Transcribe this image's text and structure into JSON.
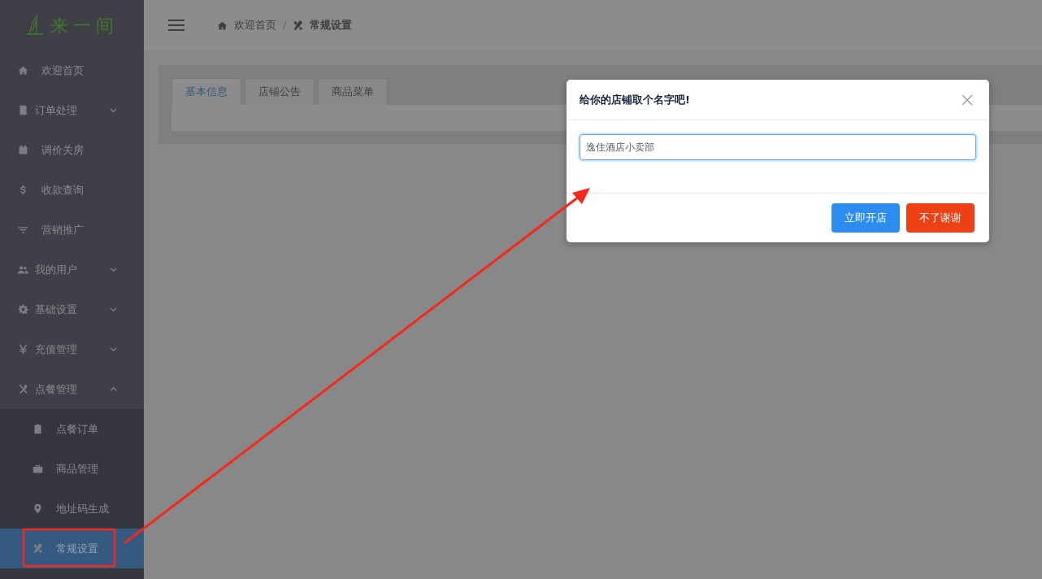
{
  "sidebar": {
    "logo": "来一间",
    "items": [
      {
        "label": "欢迎首页",
        "kind": "link",
        "selected": false
      },
      {
        "label": "订单处理",
        "kind": "group",
        "expanded": false,
        "selected": false
      },
      {
        "label": "调价关房",
        "kind": "link",
        "selected": false
      },
      {
        "label": "收款查询",
        "kind": "link",
        "selected": false
      },
      {
        "label": "营销推广",
        "kind": "link",
        "selected": false
      },
      {
        "label": "我的用户",
        "kind": "group",
        "expanded": false,
        "selected": false
      },
      {
        "label": "基础设置",
        "kind": "group",
        "expanded": false,
        "selected": false
      },
      {
        "label": "充值管理",
        "kind": "group",
        "expanded": false,
        "selected": false
      },
      {
        "label": "点餐管理",
        "kind": "group",
        "expanded": true,
        "selected": false,
        "children": [
          {
            "label": "点餐订单",
            "selected": false
          },
          {
            "label": "商品管理",
            "selected": false
          },
          {
            "label": "地址码生成",
            "selected": false
          },
          {
            "label": "常规设置",
            "selected": true
          }
        ]
      }
    ]
  },
  "breadcrumb_separator": "/",
  "breadcrumb": [
    {
      "label": "欢迎首页",
      "current": false
    },
    {
      "label": "常规设置",
      "current": true
    }
  ],
  "tabs": [
    {
      "label": "基本信息",
      "selected": true
    },
    {
      "label": "店铺公告",
      "selected": false
    },
    {
      "label": "商品菜单",
      "selected": false
    }
  ],
  "dialog": {
    "title": "给你的店铺取个名字吧!",
    "input": {
      "value": "逸住酒店小卖部",
      "focused": true
    },
    "buttons": [
      {
        "label": "立即开店",
        "kind": "primary"
      },
      {
        "label": "不了谢谢",
        "kind": "danger"
      }
    ]
  }
}
